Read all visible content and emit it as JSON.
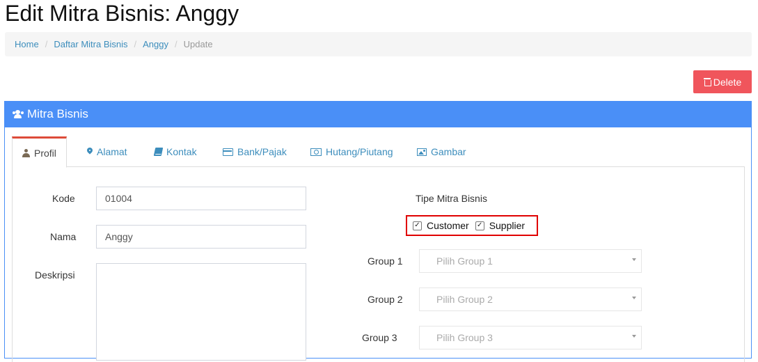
{
  "page": {
    "title": "Edit Mitra Bisnis: Anggy"
  },
  "breadcrumb": {
    "items": [
      "Home",
      "Daftar Mitra Bisnis",
      "Anggy"
    ],
    "active": "Update",
    "separator": "/"
  },
  "actions": {
    "delete_label": "Delete"
  },
  "panel": {
    "title": "Mitra Bisnis"
  },
  "tabs": [
    {
      "label": "Profil",
      "icon": "user-icon",
      "active": true
    },
    {
      "label": "Alamat",
      "icon": "map-marker-icon"
    },
    {
      "label": "Kontak",
      "icon": "book-icon"
    },
    {
      "label": "Bank/Pajak",
      "icon": "credit-card-icon"
    },
    {
      "label": "Hutang/Piutang",
      "icon": "money-icon"
    },
    {
      "label": "Gambar",
      "icon": "picture-icon"
    }
  ],
  "form": {
    "kode_label": "Kode",
    "kode_value": "01004",
    "nama_label": "Nama",
    "nama_value": "Anggy",
    "deskripsi_label": "Deskripsi",
    "deskripsi_value": "",
    "tipe_label": "Tipe Mitra Bisnis",
    "customer_label": "Customer",
    "customer_checked": true,
    "supplier_label": "Supplier",
    "supplier_checked": true,
    "groups": [
      {
        "label": "Group 1",
        "placeholder": "Pilih Group 1"
      },
      {
        "label": "Group 2",
        "placeholder": "Pilih Group 2"
      },
      {
        "label": "Group 3",
        "placeholder": "Pilih Group 3"
      }
    ]
  },
  "colors": {
    "header_blue": "#4a8ff7",
    "delete_red": "#f0555c",
    "active_tab_border": "#dd4b39",
    "link_blue": "#3c8dbc",
    "highlight_red": "#e00000"
  }
}
